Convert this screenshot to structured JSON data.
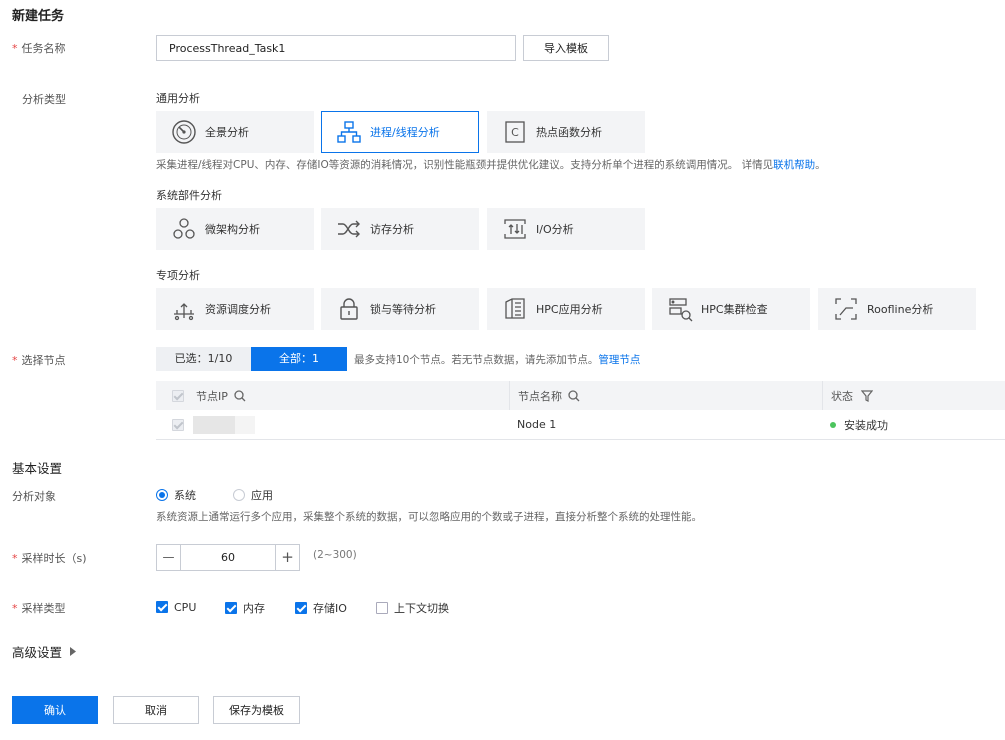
{
  "page": {
    "title": "新建任务"
  },
  "task_name": {
    "label": "任务名称",
    "value": "ProcessThread_Task1",
    "import_button": "导入模板"
  },
  "analysis_type": {
    "label": "分析类型",
    "general": {
      "heading": "通用分析",
      "cards": [
        {
          "label": "全景分析",
          "icon": "gauge-icon"
        },
        {
          "label": "进程/线程分析",
          "icon": "hierarchy-icon",
          "selected": true
        },
        {
          "label": "热点函数分析",
          "icon": "c-function-icon"
        }
      ],
      "description": "采集进程/线程对CPU、内存、存储IO等资源的消耗情况，识别性能瓶颈并提供优化建议。支持分析单个进程的系统调用情况。 详情见",
      "help_link": "联机帮助",
      "description_tail": "。"
    },
    "system": {
      "heading": "系统部件分析",
      "cards": [
        {
          "label": "微架构分析",
          "icon": "circles-icon"
        },
        {
          "label": "访存分析",
          "icon": "shuffle-icon"
        },
        {
          "label": "I/O分析",
          "icon": "io-icon"
        }
      ]
    },
    "special": {
      "heading": "专项分析",
      "cards": [
        {
          "label": "资源调度分析",
          "icon": "schedule-icon"
        },
        {
          "label": "锁与等待分析",
          "icon": "lock-icon"
        },
        {
          "label": "HPC应用分析",
          "icon": "hpc-icon"
        },
        {
          "label": "HPC集群检查",
          "icon": "cluster-check-icon"
        },
        {
          "label": "Roofline分析",
          "icon": "roofline-icon"
        }
      ]
    }
  },
  "nodes": {
    "label": "选择节点",
    "selected_tab": "已选：1/10",
    "all_tab": "全部：1",
    "hint": "最多支持10个节点。若无节点数据，请先添加节点。",
    "manage_link": "管理节点",
    "columns": [
      "节点IP",
      "节点名称",
      "状态"
    ],
    "rows": [
      {
        "ip": "",
        "name": "Node 1",
        "status": "安装成功",
        "status_color": "#4cc45d"
      }
    ]
  },
  "basic": {
    "heading": "基本设置",
    "target_label": "分析对象",
    "target_options": [
      {
        "label": "系统",
        "checked": true
      },
      {
        "label": "应用",
        "checked": false
      }
    ],
    "target_desc": "系统资源上通常运行多个应用，采集整个系统的数据，可以忽略应用的个数或子进程，直接分析整个系统的处理性能。",
    "duration_label": "采样时长（s)",
    "duration_value": "60",
    "duration_minus": "—",
    "duration_plus": "+",
    "duration_range": "(2~300)",
    "sample_type_label": "采样类型",
    "sample_types": [
      {
        "label": "CPU",
        "checked": true
      },
      {
        "label": "内存",
        "checked": true
      },
      {
        "label": "存储IO",
        "checked": true
      },
      {
        "label": "上下文切换",
        "checked": false
      }
    ]
  },
  "advanced": {
    "heading": "高级设置"
  },
  "footer": {
    "confirm": "确认",
    "cancel": "取消",
    "save_template": "保存为模板"
  },
  "colors": {
    "accent": "#0a74ea",
    "required": "#e54545",
    "card_bg": "#f3f4f6"
  }
}
